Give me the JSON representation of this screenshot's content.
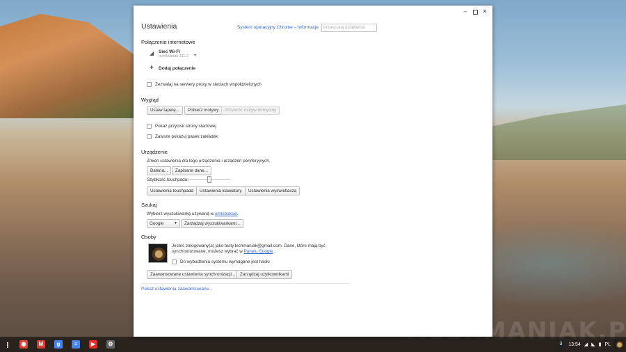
{
  "window": {
    "title": "Ustawienia",
    "about_link": "System operacyjny Chrome – informacje",
    "search_placeholder": "Przeszukaj ustawienia",
    "minimize_glyph": "–",
    "close_glyph": "✕"
  },
  "internet": {
    "section_title": "Połączenie internetowe",
    "network_name": "Sieć Wi-Fi",
    "network_ssid": "techManiak-111.2",
    "add_connection": "Dodaj połączenie",
    "proxy_label": "Zezwalaj na serwery proxy w sieciach współdzielonych"
  },
  "appearance": {
    "section_title": "Wygląd",
    "set_wallpaper": "Ustaw tapetę...",
    "get_themes": "Pobierz motywy",
    "reset_theme": "Przywróć motyw domyślny",
    "home_button": "Pokaż przycisk strony startowej",
    "bookmarks_bar": "Zawsze pokazuj pasek zakładek"
  },
  "device": {
    "section_title": "Urządzenie",
    "description": "Zmień ustawienia dla tego urządzenia i urządzeń peryferyjnych.",
    "battery": "Bateria...",
    "saved_data": "Zapisane dane...",
    "touchpad_speed": "Szybkość touchpada:",
    "touchpad_speed_level": 0.5,
    "touchpad_settings": "Ustawienia touchpada",
    "keyboard_settings": "Ustawienia klawiatury",
    "display_settings": "Ustawienia wyświetlacza"
  },
  "search": {
    "section_title": "Szukaj",
    "description_prefix": "Wybierz wyszukiwarkę używaną w ",
    "omnibox_link": "omniboksie",
    "description_suffix": ".",
    "engine_selected": "Google",
    "manage_engines": "Zarządzaj wyszukiwarkami..."
  },
  "people": {
    "section_title": "Osoby",
    "signed_in_line1": "Jesteś zalogowany(a) jako testy.techmaniak@gmail.com. Dane, które mają być",
    "signed_in_line2_prefix": "synchronizowane, możesz wybrać w ",
    "google_panel_link": "Panelu Google",
    "signed_in_line2_suffix": ".",
    "require_password": "Do wybudzenia systemu wymagane jest hasło",
    "advanced_sync": "Zaawansowane ustawienia synchronizacji...",
    "manage_users": "Zarządzaj użytkownikami"
  },
  "advanced_link": "Pokaż ustawienia zaawansowane...",
  "shelf": {
    "apps": [
      {
        "icon": "chrome-icon",
        "color": "#db4437"
      },
      {
        "icon": "gmail-icon",
        "color": "#d23f31"
      },
      {
        "icon": "google-search-icon",
        "color": "#4285f4"
      },
      {
        "icon": "google-docs-icon",
        "color": "#4a86e8"
      },
      {
        "icon": "youtube-icon",
        "color": "#e52d27"
      },
      {
        "icon": "settings-icon",
        "color": "#666666"
      }
    ],
    "notification_count": "3",
    "time": "13:54",
    "language": "PL"
  },
  "watermark": "ACERMANIAK.PL"
}
